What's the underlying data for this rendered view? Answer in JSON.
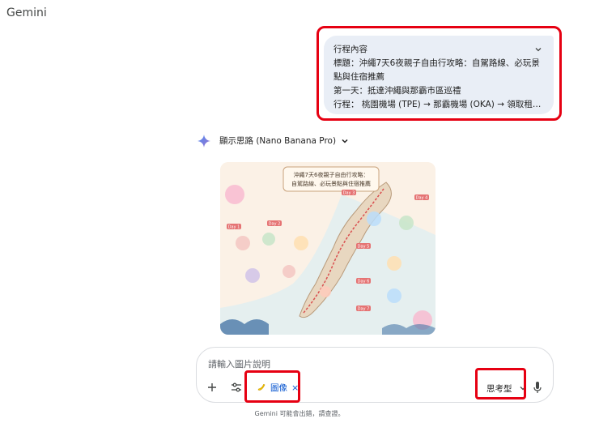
{
  "app": {
    "title": "Gemini"
  },
  "user_message": {
    "heading": "行程內容",
    "title_line": "標題：沖繩7天6夜親子自由行攻略：自駕路線、必玩景點與住宿推薦",
    "day_line": "第一天：抵達沖繩與那霸市區巡禮",
    "itinerary_line": "行程： 桃園機場 (TPE) → 那霸機場 (OKA) → 領取租車 …"
  },
  "assistant": {
    "thinking_label": "顯示思路 (Nano Banana Pro)"
  },
  "image": {
    "title_line1": "沖繩7天6夜親子自由行攻略：",
    "title_line2": "自駕路線、必玩景點與住宿推薦",
    "days": [
      "Day 1",
      "Day 2",
      "Day 3",
      "Day 4",
      "Day 5",
      "Day 6",
      "Day 7"
    ]
  },
  "composer": {
    "placeholder": "請輸入圖片說明",
    "chip_label": "圖像",
    "chip_close": "×",
    "mode_label": "思考型"
  },
  "footer": {
    "disclaimer": "Gemini 可能會出錯，請查證。"
  },
  "colors": {
    "highlight": "#e60012",
    "bubble": "#e9eef6",
    "accent": "#0b57d0"
  }
}
